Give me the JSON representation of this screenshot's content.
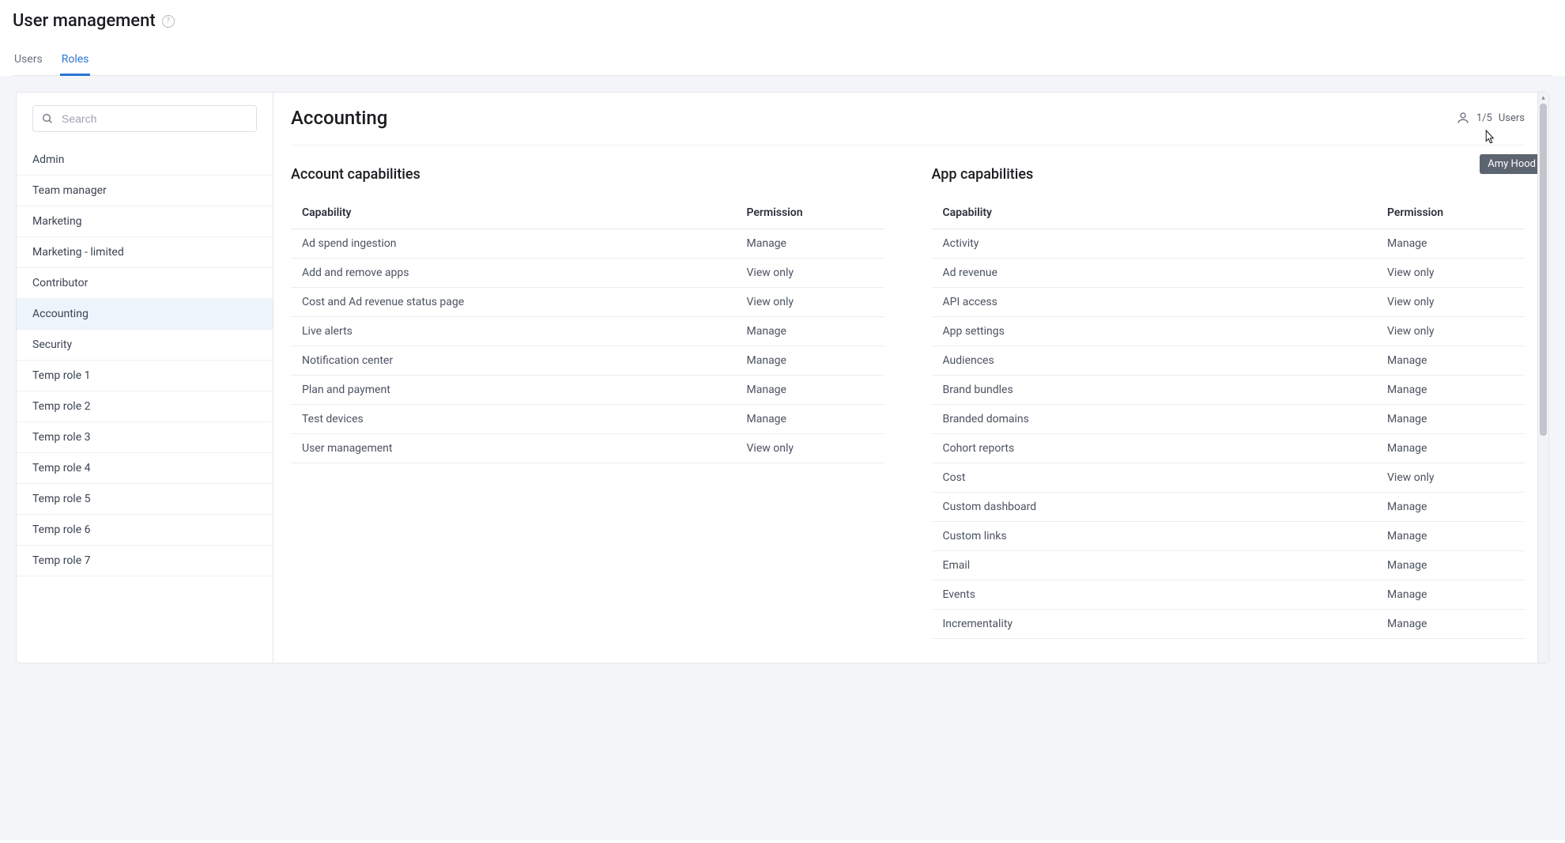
{
  "header": {
    "title": "User management",
    "tabs": [
      "Users",
      "Roles"
    ],
    "active_tab": 1
  },
  "sidebar": {
    "search_placeholder": "Search",
    "roles": [
      "Admin",
      "Team manager",
      "Marketing",
      "Marketing - limited",
      "Contributor",
      "Accounting",
      "Security",
      "Temp role 1",
      "Temp role 2",
      "Temp role 3",
      "Temp role 4",
      "Temp role 5",
      "Temp role 6",
      "Temp role 7"
    ],
    "selected_index": 5
  },
  "detail": {
    "role_name": "Accounting",
    "users_count": "1/5",
    "users_label": "Users",
    "tooltip": "Amy Hood",
    "account_caps_heading": "Account capabilities",
    "app_caps_heading": "App capabilities",
    "col_capability": "Capability",
    "col_permission": "Permission",
    "account_caps": [
      {
        "name": "Ad spend ingestion",
        "perm": "Manage"
      },
      {
        "name": "Add and remove apps",
        "perm": "View only"
      },
      {
        "name": "Cost and Ad revenue status page",
        "perm": "View only"
      },
      {
        "name": "Live alerts",
        "perm": "Manage"
      },
      {
        "name": "Notification center",
        "perm": "Manage"
      },
      {
        "name": "Plan and payment",
        "perm": "Manage"
      },
      {
        "name": "Test devices",
        "perm": "Manage"
      },
      {
        "name": "User management",
        "perm": "View only"
      }
    ],
    "app_caps": [
      {
        "name": "Activity",
        "perm": "Manage"
      },
      {
        "name": "Ad revenue",
        "perm": "View only"
      },
      {
        "name": "API access",
        "perm": "View only"
      },
      {
        "name": "App settings",
        "perm": "View only"
      },
      {
        "name": "Audiences",
        "perm": "Manage"
      },
      {
        "name": "Brand bundles",
        "perm": "Manage"
      },
      {
        "name": "Branded domains",
        "perm": "Manage"
      },
      {
        "name": "Cohort reports",
        "perm": "Manage"
      },
      {
        "name": "Cost",
        "perm": "View only"
      },
      {
        "name": "Custom dashboard",
        "perm": "Manage"
      },
      {
        "name": "Custom links",
        "perm": "Manage"
      },
      {
        "name": "Email",
        "perm": "Manage"
      },
      {
        "name": "Events",
        "perm": "Manage"
      },
      {
        "name": "Incrementality",
        "perm": "Manage"
      }
    ]
  }
}
